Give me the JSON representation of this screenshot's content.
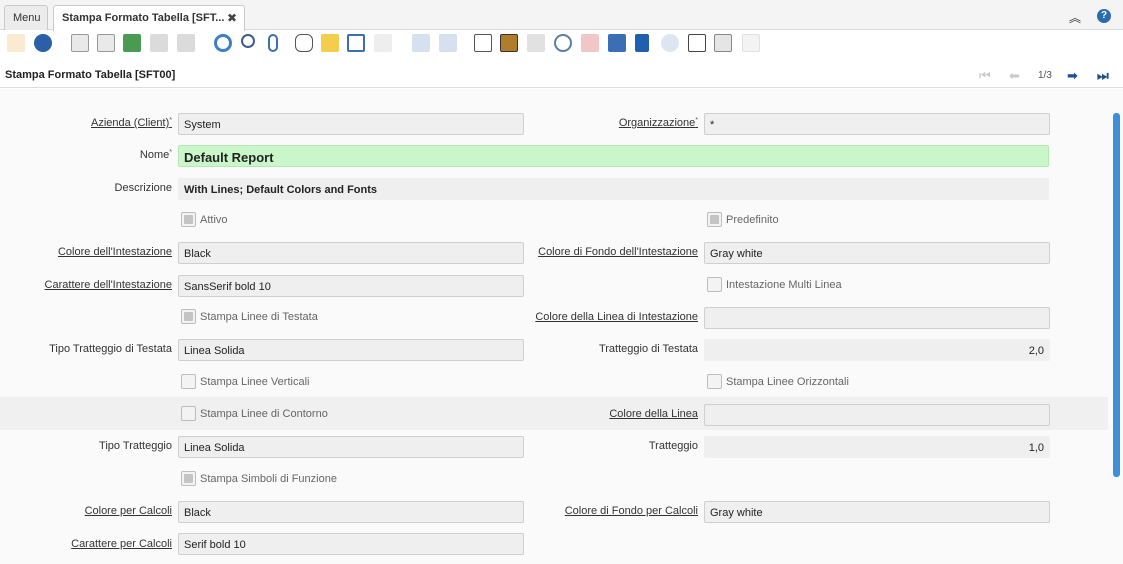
{
  "tabs": {
    "menu_label": "Menu",
    "active_label": "Stampa Formato Tabella [SFT...",
    "close_glyph": "✖",
    "collapse_glyph": "︽",
    "help_glyph": "?"
  },
  "toolbar": {
    "icons": [
      "undo-icon",
      "help-icon",
      "new-record-icon",
      "copy-record-icon",
      "delete-icon",
      "save-icon",
      "delete-selection-icon",
      "refresh-icon",
      "find-icon",
      "attachment-icon",
      "chat-icon",
      "note-icon",
      "grid-toggle-icon",
      "multi-row-icon",
      "previous-parent-icon",
      "next-child-icon",
      "report-icon",
      "archive-icon",
      "print-icon",
      "zoom-across-icon",
      "active-workflows-icon",
      "request-icon",
      "product-info-icon",
      "process-icon",
      "settings-icon",
      "import-icon",
      "export-icon",
      "fullscreen-icon"
    ]
  },
  "header": {
    "title": "Stampa Formato Tabella [SFT00]",
    "record_counter": "1/3",
    "nav_first": "⏮",
    "nav_prev": "⬅",
    "nav_next": "➡",
    "nav_last": "⏭"
  },
  "form": {
    "client_label": "Azienda (Client)",
    "client_value": "System",
    "org_label": "Organizzazione",
    "org_value": "*",
    "required_mark": "*",
    "name_label": "Nome",
    "name_value": "Default Report",
    "description_label": "Descrizione",
    "description_value": "With Lines; Default Colors and Fonts",
    "active_label": "Attivo",
    "default_label": "Predefinito",
    "header_color_label": "Colore dell'Intestazione",
    "header_color_value": "Black",
    "header_bg_label": "Colore di Fondo dell'Intestazione",
    "header_bg_value": "Gray white",
    "header_font_label": "Carattere dell'Intestazione",
    "header_font_value": "SansSerif bold 10",
    "multiline_header_label": "Intestazione Multi Linea",
    "print_header_lines_label": "Stampa Linee di Testata",
    "header_line_color_label": "Colore della Linea di Intestazione",
    "header_line_color_value": "",
    "header_stroke_type_label": "Tipo Tratteggio di Testata",
    "header_stroke_type_value": "Linea Solida",
    "header_stroke_label": "Tratteggio di Testata",
    "header_stroke_value": "2,0",
    "vertical_lines_label": "Stampa Linee Verticali",
    "horizontal_lines_label": "Stampa Linee Orizzontali",
    "border_lines_label": "Stampa Linee di Contorno",
    "line_color_label": "Colore della Linea",
    "line_color_value": "",
    "stroke_type_label": "Tipo Tratteggio",
    "stroke_type_value": "Linea Solida",
    "stroke_label": "Tratteggio",
    "stroke_value": "1,0",
    "function_symbols_label": "Stampa Simboli di Funzione",
    "calc_color_label": "Colore per Calcoli",
    "calc_color_value": "Black",
    "calc_bg_label": "Colore di Fondo per Calcoli",
    "calc_bg_value": "Gray white",
    "calc_font_label": "Carattere per Calcoli",
    "calc_font_value": "Serif bold 10"
  },
  "colors": {
    "accent": "#1f4f8f",
    "scroll_thumb": "#3d8fd9",
    "mandatory_bg": "#c9f7c9"
  }
}
